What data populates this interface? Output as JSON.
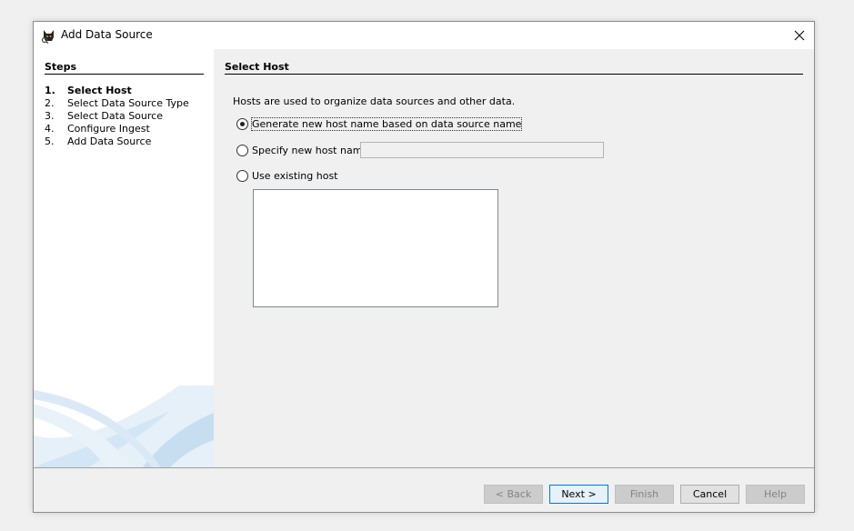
{
  "window": {
    "title": "Add Data Source"
  },
  "steps": {
    "header": "Steps",
    "items": [
      {
        "num": "1.",
        "label": "Select Host"
      },
      {
        "num": "2.",
        "label": "Select Data Source Type"
      },
      {
        "num": "3.",
        "label": "Select Data Source"
      },
      {
        "num": "4.",
        "label": "Configure Ingest"
      },
      {
        "num": "5.",
        "label": "Add Data Source"
      }
    ],
    "current_index": 0
  },
  "main": {
    "header": "Select Host",
    "description": "Hosts are used to organize data sources and other data.",
    "options": [
      {
        "label": "Generate new host name based on data source name",
        "selected": true
      },
      {
        "label": "Specify new host name",
        "selected": false
      },
      {
        "label": "Use existing host",
        "selected": false
      }
    ],
    "host_name_value": ""
  },
  "footer": {
    "back_label": "< Back",
    "next_label": "Next >",
    "finish_label": "Finish",
    "cancel_label": "Cancel",
    "help_label": "Help"
  },
  "colors": {
    "dialog_background": "#f0f0f0",
    "panel_white": "#ffffff",
    "default_button_border": "#0078d7",
    "decoration_blue": "#cfe4f3"
  }
}
